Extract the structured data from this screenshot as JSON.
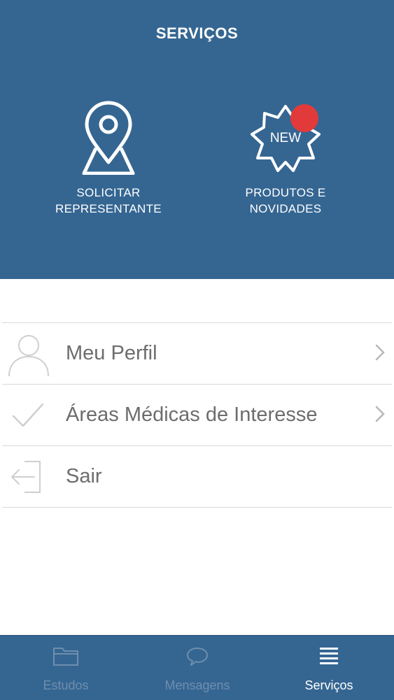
{
  "header": {
    "title": "SERVIÇOS",
    "services": [
      {
        "label": "SOLICITAR\nREPRESENTANTE",
        "icon": "map-pin-icon"
      },
      {
        "label": "PRODUTOS E\nNOVIDADES",
        "icon": "new-badge-icon",
        "badge_text": "NEW",
        "notification_color": "#e23a3a"
      }
    ]
  },
  "menu": [
    {
      "label": "Meu Perfil",
      "icon": "user-icon",
      "has_chevron": true
    },
    {
      "label": "Áreas Médicas de Interesse",
      "icon": "checkmark-icon",
      "has_chevron": true
    },
    {
      "label": "Sair",
      "icon": "logout-icon",
      "has_chevron": false
    }
  ],
  "tabs": [
    {
      "label": "Estudos",
      "icon": "folder-icon",
      "active": false
    },
    {
      "label": "Mensagens",
      "icon": "chat-bubble-icon",
      "active": false
    },
    {
      "label": "Serviços",
      "icon": "menu-lines-icon",
      "active": true
    }
  ],
  "colors": {
    "primary": "#356692",
    "tab_active": "#ffffff",
    "tab_inactive": "#6f8ead",
    "list_text": "#6d6d6d",
    "divider": "#d8d8d8"
  }
}
